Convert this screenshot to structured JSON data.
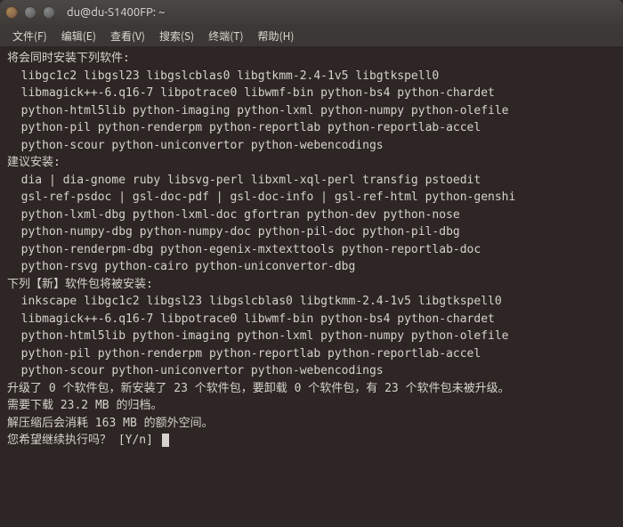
{
  "window": {
    "title": "du@du-S1400FP: ~"
  },
  "menu": {
    "file": "文件(F)",
    "edit": "编辑(E)",
    "view": "查看(V)",
    "search": "搜索(S)",
    "terminal": "终端(T)",
    "help": "帮助(H)"
  },
  "apt": {
    "extra_header": "将会同时安装下列软件:",
    "extra_lines": [
      "libgc1c2 libgsl23 libgslcblas0 libgtkmm-2.4-1v5 libgtkspell0",
      "libmagick++-6.q16-7 libpotrace0 libwmf-bin python-bs4 python-chardet",
      "python-html5lib python-imaging python-lxml python-numpy python-olefile",
      "python-pil python-renderpm python-reportlab python-reportlab-accel",
      "python-scour python-uniconvertor python-webencodings"
    ],
    "suggested_header": "建议安装:",
    "suggested_lines": [
      "dia | dia-gnome ruby libsvg-perl libxml-xql-perl transfig pstoedit",
      "gsl-ref-psdoc | gsl-doc-pdf | gsl-doc-info | gsl-ref-html python-genshi",
      "python-lxml-dbg python-lxml-doc gfortran python-dev python-nose",
      "python-numpy-dbg python-numpy-doc python-pil-doc python-pil-dbg",
      "python-renderpm-dbg python-egenix-mxtexttools python-reportlab-doc",
      "python-rsvg python-cairo python-uniconvertor-dbg"
    ],
    "new_header": "下列【新】软件包将被安装:",
    "new_lines": [
      "inkscape libgc1c2 libgsl23 libgslcblas0 libgtkmm-2.4-1v5 libgtkspell0",
      "libmagick++-6.q16-7 libpotrace0 libwmf-bin python-bs4 python-chardet",
      "python-html5lib python-imaging python-lxml python-numpy python-olefile",
      "python-pil python-renderpm python-reportlab python-reportlab-accel",
      "python-scour python-uniconvertor python-webencodings"
    ],
    "summary1": "升级了 0 个软件包，新安装了 23 个软件包，要卸载 0 个软件包，有 23 个软件包未被升级。",
    "summary2": "需要下载 23.2 MB 的归档。",
    "summary3": "解压缩后会消耗 163 MB 的额外空间。",
    "prompt": "您希望继续执行吗？ [Y/n]"
  }
}
